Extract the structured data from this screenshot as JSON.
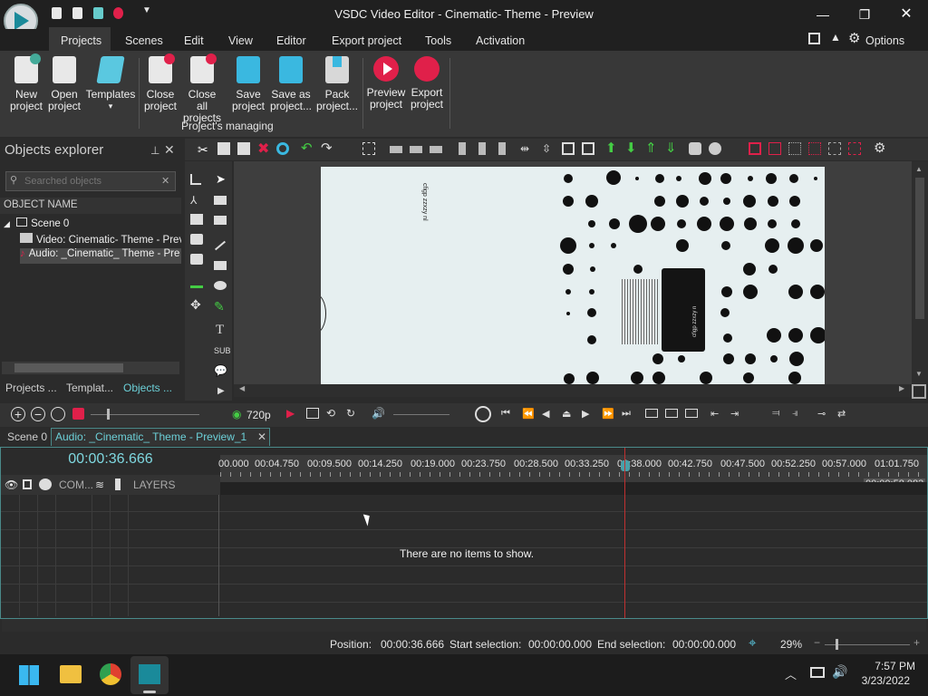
{
  "window": {
    "title": "VSDC Video Editor - Cinematic- Theme - Preview"
  },
  "menu": {
    "items": [
      "Projects",
      "Scenes",
      "Edit",
      "View",
      "Editor",
      "Export project",
      "Tools",
      "Activation"
    ],
    "options_label": "Options"
  },
  "ribbon": {
    "buttons": [
      {
        "l1": "New",
        "l2": "project"
      },
      {
        "l1": "Open",
        "l2": "project"
      },
      {
        "l1": "Templates",
        "l2": "▾"
      },
      {
        "l1": "Close",
        "l2": "project"
      },
      {
        "l1": "Close all",
        "l2": "projects"
      },
      {
        "l1": "Save",
        "l2": "project"
      },
      {
        "l1": "Save as",
        "l2": "project..."
      },
      {
        "l1": "Pack",
        "l2": "project..."
      },
      {
        "l1": "Preview",
        "l2": "project"
      },
      {
        "l1": "Export",
        "l2": "project"
      }
    ],
    "group_label": "Project's managing"
  },
  "objects_explorer": {
    "title": "Objects explorer",
    "search_placeholder": "Searched objects",
    "column_header": "OBJECT NAME",
    "tree": [
      "Scene 0",
      "Video: Cinematic- Theme - Prev",
      "Audio: _Cinematic_ Theme - Pre"
    ],
    "bottom_tabs": [
      "Projects ...",
      "Templat...",
      "Objects ..."
    ]
  },
  "preview": {
    "resolution": "720p",
    "text1": "cfigp zzxzy nl",
    "text2": "cfigp zzxzy n"
  },
  "timeline": {
    "scene_tab": "Scene 0",
    "file_tab": "Audio: _Cinematic_ Theme - Preview_1",
    "timecode": "00:00:36.666",
    "ruler_ticks": [
      "00.000",
      "00:04.750",
      "00:09.500",
      "00:14.250",
      "00:19.000",
      "00:23.750",
      "00:28.500",
      "00:33.250",
      "00:38.000",
      "00:42.750",
      "00:47.500",
      "00:52.250",
      "00:57.000",
      "01:01.750"
    ],
    "end_marker": "00:00:58.083",
    "layers_header": [
      "COM...",
      "LAYERS"
    ],
    "empty_message": "There are no items to show."
  },
  "status": {
    "position_label": "Position:",
    "position_value": "00:00:36.666",
    "start_label": "Start selection:",
    "start_value": "00:00:00.000",
    "end_label": "End selection:",
    "end_value": "00:00:00.000",
    "zoom": "29%"
  },
  "taskbar": {
    "time": "7:57 PM",
    "date": "3/23/2022"
  },
  "colors": {
    "accent": "#4aa0a8",
    "timecode": "#7fd8e0",
    "playhead": "#c03030"
  }
}
